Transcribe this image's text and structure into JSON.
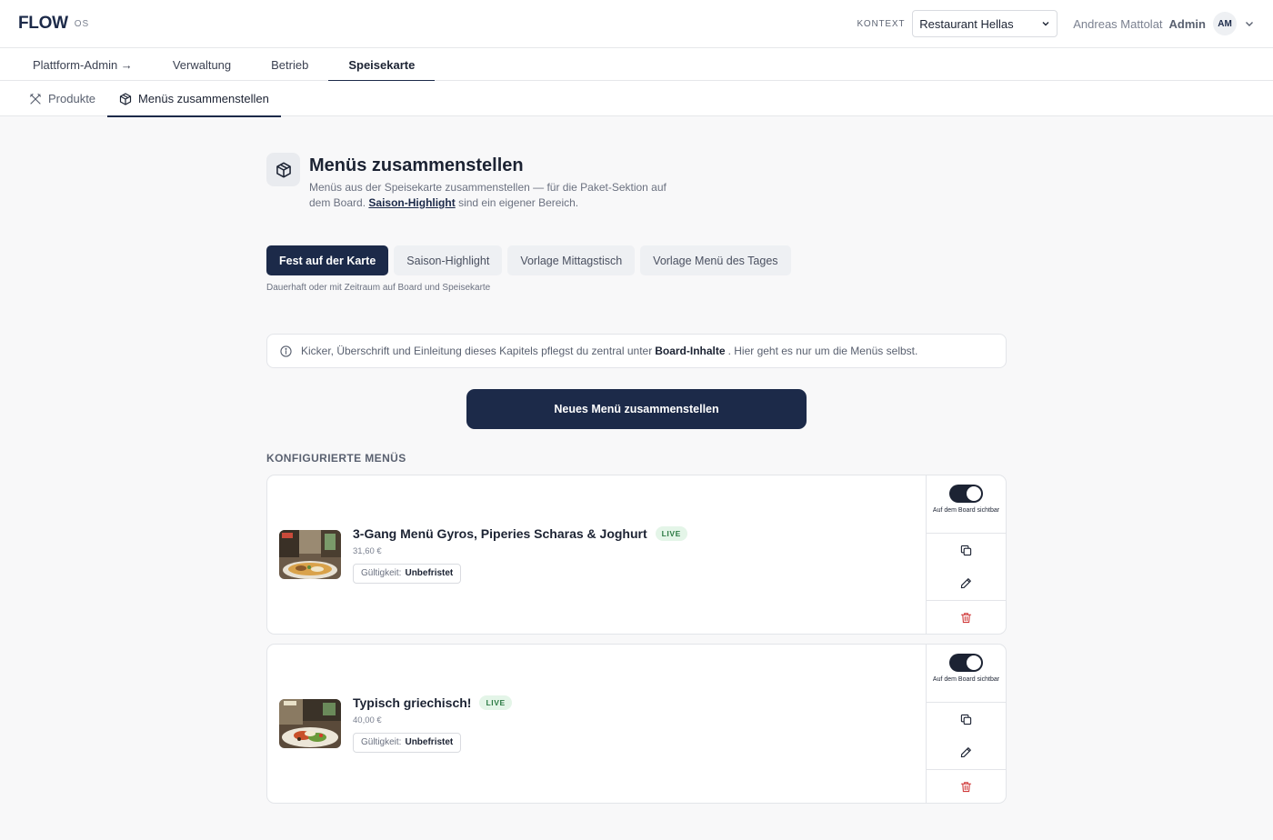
{
  "header": {
    "logo": "FLOW",
    "logo_suffix": "OS",
    "context_label": "KONTEXT",
    "context_value": "Restaurant Hellas",
    "user_name": "Andreas Mattolat",
    "user_role": "Admin",
    "avatar_initials": "AM"
  },
  "main_tabs": [
    {
      "label": "Plattform-Admin →"
    },
    {
      "label": "Verwaltung"
    },
    {
      "label": "Betrieb"
    },
    {
      "label": "Speisekarte",
      "active": true
    }
  ],
  "sub_tabs": [
    {
      "label": "Produkte",
      "icon": "utensils-icon"
    },
    {
      "label": "Menüs zusammenstellen",
      "icon": "package-icon",
      "active": true
    }
  ],
  "page": {
    "title": "Menüs zusammenstellen",
    "desc_before": "Menüs aus der Speisekarte zusammenstellen — für die Paket-Sektion auf dem Board.",
    "desc_link": "Saison-Highlight",
    "desc_after": "sind ein eigener Bereich."
  },
  "type_tabs": [
    {
      "label": "Fest auf der Karte",
      "active": true
    },
    {
      "label": "Saison-Highlight"
    },
    {
      "label": "Vorlage Mittagstisch"
    },
    {
      "label": "Vorlage Menü des Tages"
    }
  ],
  "type_hint": "Dauerhaft oder mit Zeitraum auf Board und Speisekarte",
  "info": {
    "before": "Kicker, Überschrift und Einleitung dieses Kapitels pflegst du zentral unter",
    "bold": "Board-Inhalte",
    "after": ". Hier geht es nur um die Menüs selbst."
  },
  "new_button": "Neues Menü zusammenstellen",
  "section_title": "KONFIGURIERTE MENÜS",
  "menus": [
    {
      "title": "3-Gang Menü Gyros, Piperies Scharas & Joghurt",
      "badge": "LIVE",
      "price": "31,60 €",
      "validity_label": "Gültigkeit:",
      "validity_value": "Unbefristet",
      "toggle_label": "Auf dem Board sichtbar",
      "board_visible": true
    },
    {
      "title": "Typisch griechisch!",
      "badge": "LIVE",
      "price": "40,00 €",
      "validity_label": "Gültigkeit:",
      "validity_value": "Unbefristet",
      "toggle_label": "Auf dem Board sichtbar",
      "board_visible": true
    }
  ],
  "colors": {
    "primary": "#1c2a49",
    "live_bg": "#e4f5e8",
    "live_text": "#2c7a43",
    "danger": "#d03a3a"
  }
}
